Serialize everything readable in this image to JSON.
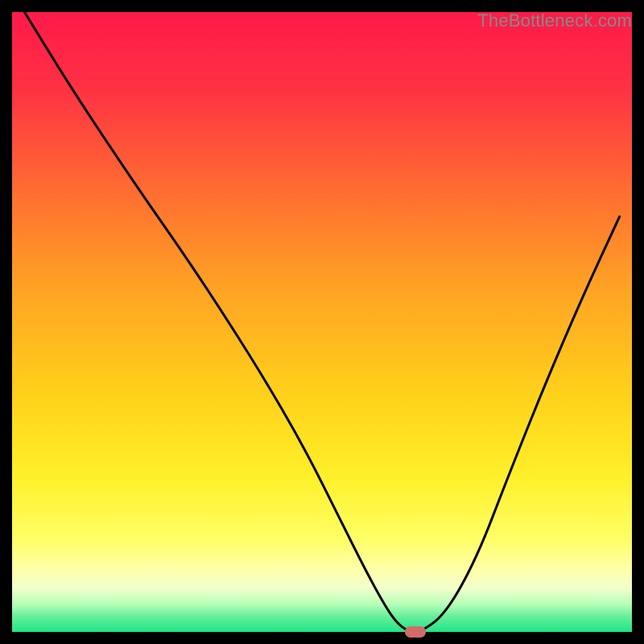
{
  "watermark": "TheBottleneck.com",
  "chart_data": {
    "type": "line",
    "title": "",
    "xlabel": "",
    "ylabel": "",
    "xlim": [
      0,
      100
    ],
    "ylim": [
      0,
      100
    ],
    "grid": false,
    "legend": false,
    "background_gradient_stops": [
      {
        "offset": 0.0,
        "color": "#ff1a4a"
      },
      {
        "offset": 0.12,
        "color": "#ff3044"
      },
      {
        "offset": 0.28,
        "color": "#ff6a32"
      },
      {
        "offset": 0.45,
        "color": "#ffa424"
      },
      {
        "offset": 0.62,
        "color": "#ffd21a"
      },
      {
        "offset": 0.75,
        "color": "#fff02a"
      },
      {
        "offset": 0.85,
        "color": "#ffff66"
      },
      {
        "offset": 0.9,
        "color": "#ffffaa"
      },
      {
        "offset": 0.93,
        "color": "#f0ffcc"
      },
      {
        "offset": 0.955,
        "color": "#b8ffb8"
      },
      {
        "offset": 0.975,
        "color": "#66ee99"
      },
      {
        "offset": 1.0,
        "color": "#1ee68a"
      }
    ],
    "series": [
      {
        "name": "bottleneck-curve",
        "color": "#000000",
        "x": [
          2,
          10,
          20,
          27,
          33,
          40,
          47,
          53,
          57,
          60,
          62,
          64,
          66,
          70,
          75,
          80,
          86,
          92,
          98
        ],
        "y": [
          100,
          87,
          72,
          62,
          53,
          42,
          30,
          18,
          10,
          4.5,
          1.5,
          0,
          0,
          3,
          12,
          25,
          40,
          54,
          67
        ]
      }
    ],
    "marker": {
      "x": 65,
      "y": 0,
      "color": "#d36a6a"
    }
  }
}
